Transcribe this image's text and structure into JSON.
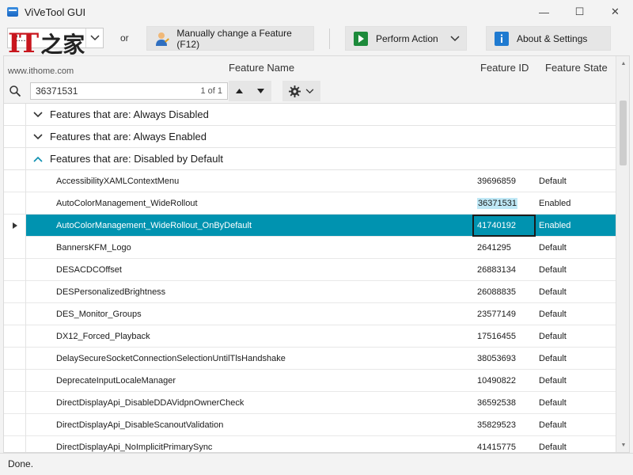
{
  "window": {
    "title": "ViVeTool GUI",
    "minimize": "—",
    "maximize": "☐",
    "close": "✕"
  },
  "toolbar": {
    "build_value": "2...",
    "or_label": "or",
    "manual_label": "Manually change a Feature (F12)",
    "perform_label": "Perform Action",
    "about_label": "About & Settings"
  },
  "logo": {
    "mark": "IT",
    "cn": "之家",
    "url": "www.ithome.com"
  },
  "grid": {
    "headers": {
      "name": "Feature Name",
      "id": "Feature ID",
      "state": "Feature State"
    },
    "search": {
      "value": "36371531",
      "count": "1 of 1"
    },
    "groups": [
      {
        "label": "Features that are: Always Disabled",
        "expanded": false
      },
      {
        "label": "Features that are: Always Enabled",
        "expanded": false
      },
      {
        "label": "Features that are: Disabled by Default",
        "expanded": true
      }
    ],
    "rows": [
      {
        "name": "AccessibilityXAMLContextMenu",
        "id": "39696859",
        "state": "Default"
      },
      {
        "name": "AutoColorManagement_WideRollout",
        "id": "36371531",
        "state": "Enabled"
      },
      {
        "name": "AutoColorManagement_WideRollout_OnByDefault",
        "id": "41740192",
        "state": "Enabled"
      },
      {
        "name": "BannersKFM_Logo",
        "id": "2641295",
        "state": "Default"
      },
      {
        "name": "DESACDCOffset",
        "id": "26883134",
        "state": "Default"
      },
      {
        "name": "DESPersonalizedBrightness",
        "id": "26088835",
        "state": "Default"
      },
      {
        "name": "DES_Monitor_Groups",
        "id": "23577149",
        "state": "Default"
      },
      {
        "name": "DX12_Forced_Playback",
        "id": "17516455",
        "state": "Default"
      },
      {
        "name": "DelaySecureSocketConnectionSelectionUntilTlsHandshake",
        "id": "38053693",
        "state": "Default"
      },
      {
        "name": "DeprecateInputLocaleManager",
        "id": "10490822",
        "state": "Default"
      },
      {
        "name": "DirectDisplayApi_DisableDDAVidpnOwnerCheck",
        "id": "36592538",
        "state": "Default"
      },
      {
        "name": "DirectDisplayApi_DisableScanoutValidation",
        "id": "35829523",
        "state": "Default"
      },
      {
        "name": "DirectDisplayApi_NoImplicitPrimarySync",
        "id": "41415775",
        "state": "Default"
      }
    ]
  },
  "status": {
    "text": "Done."
  },
  "colors": {
    "selection": "#0093b0",
    "highlight": "#bfe8f6",
    "logo_red": "#c8161e"
  }
}
